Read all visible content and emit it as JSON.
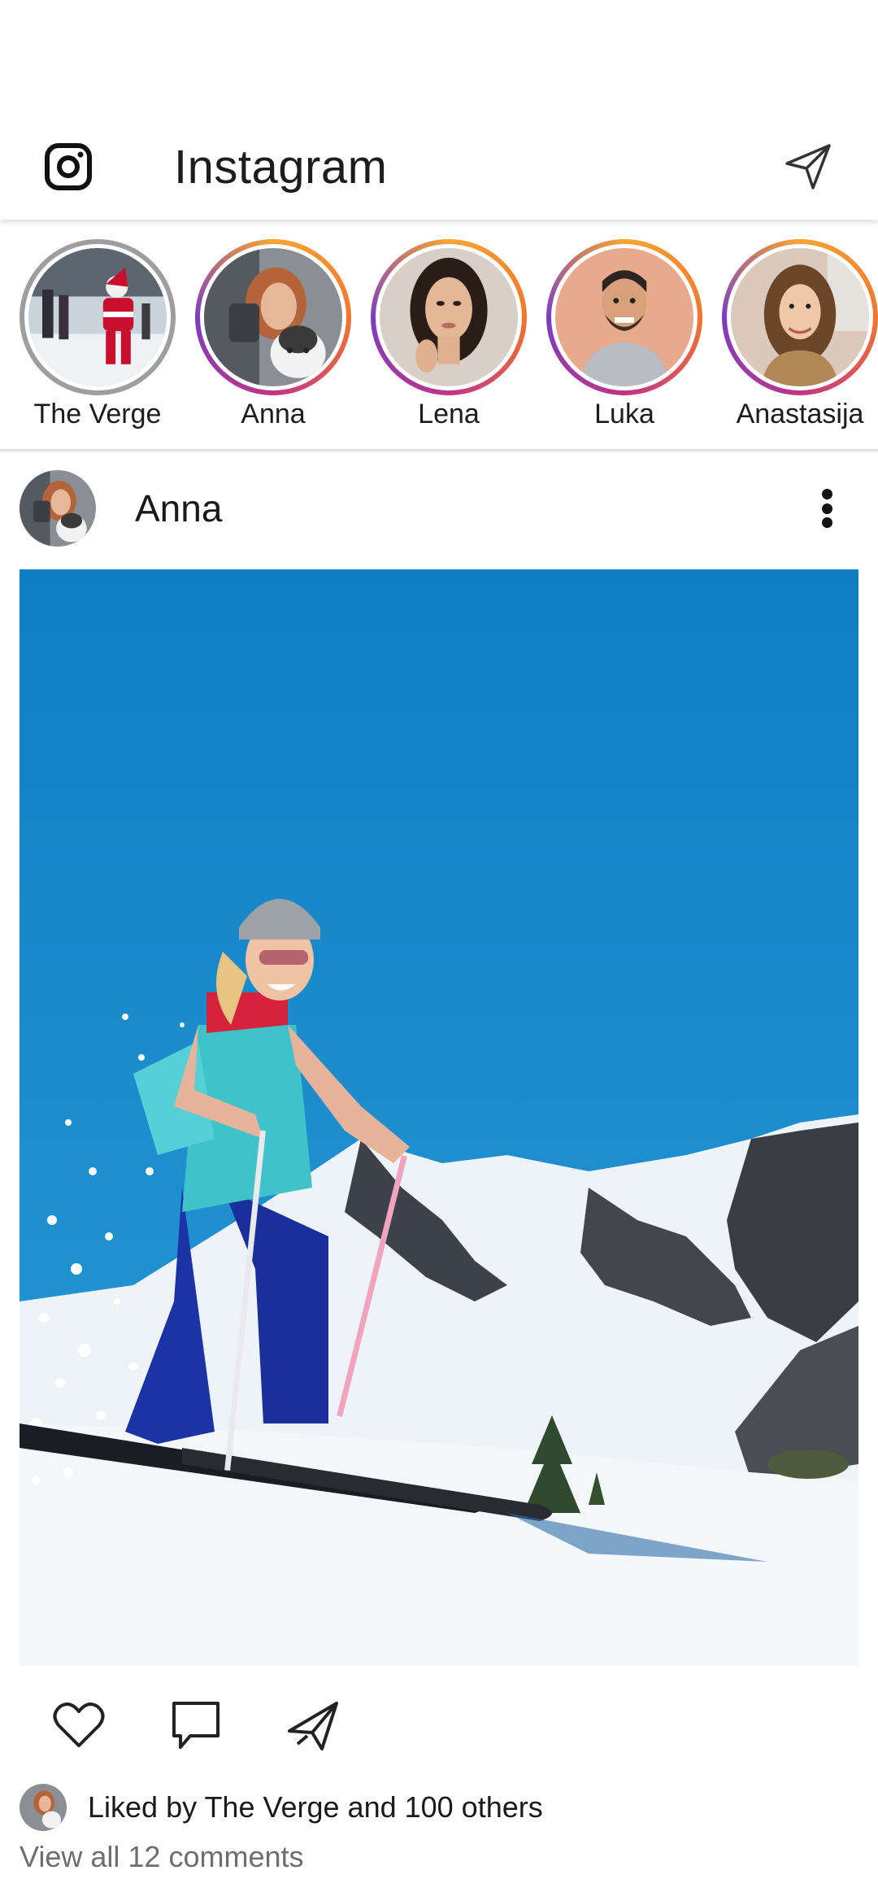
{
  "app": {
    "title": "Instagram"
  },
  "icons": {
    "brand": "instagram-logo-icon",
    "direct": "paper-plane-icon",
    "more": "more-vertical-icon",
    "like": "heart-icon",
    "comment": "comment-bubble-icon",
    "share": "paper-plane-icon"
  },
  "stories": [
    {
      "name": "The Verge",
      "seen": true
    },
    {
      "name": "Anna",
      "seen": false
    },
    {
      "name": "Lena",
      "seen": false
    },
    {
      "name": "Luka",
      "seen": false
    },
    {
      "name": "Anastasija",
      "seen": false
    }
  ],
  "post": {
    "username": "Anna",
    "likes_text": "Liked by The Verge and 100 others",
    "comments_text": "View all 12 comments"
  },
  "colors": {
    "ring_start": "#f7a531",
    "ring_end": "#7b3fbf",
    "sky": "#1487c8"
  }
}
